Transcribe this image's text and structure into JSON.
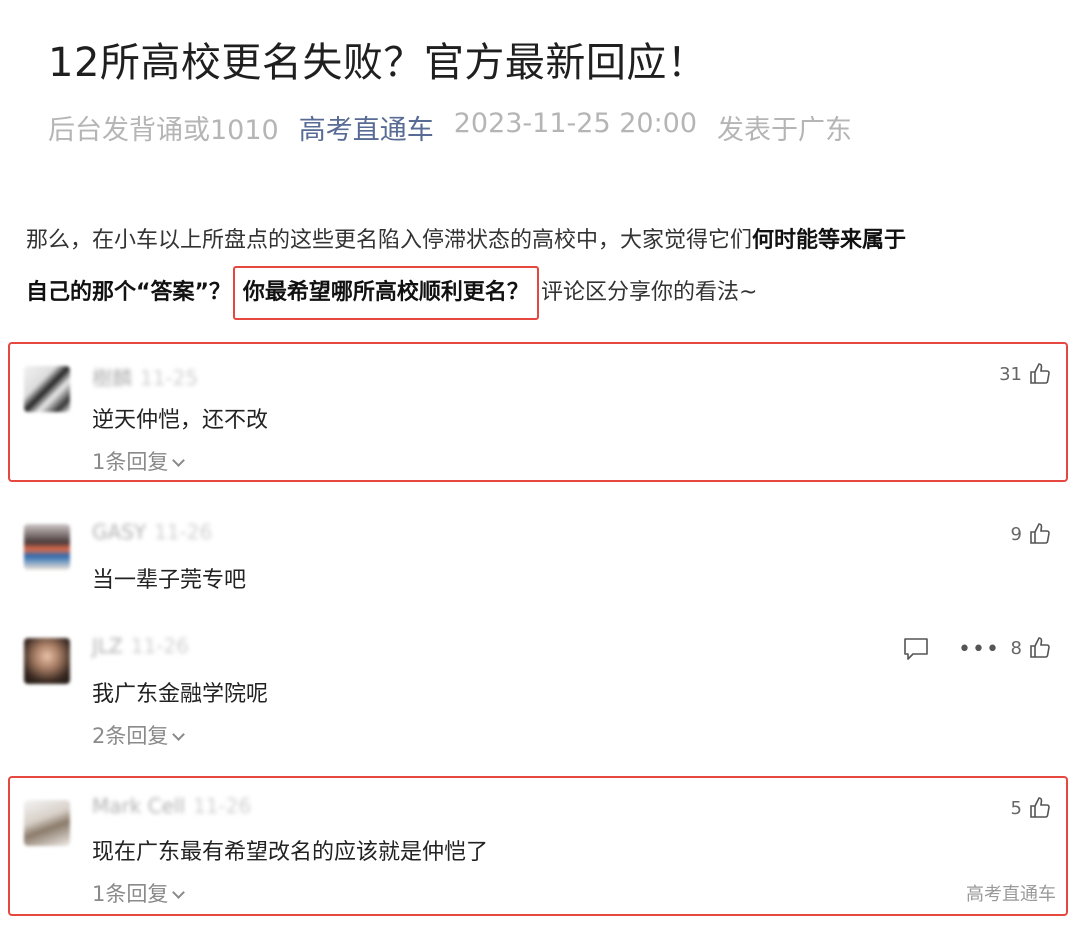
{
  "article": {
    "title": "12所高校更名失败？官方最新回应！",
    "meta_hint": "后台发背诵或1010",
    "account": "高考直通车",
    "datetime": "2023-11-25 20:00",
    "location": "发表于广东"
  },
  "intro": {
    "line1_plain": "那么，在小车以上所盘点的这些更名陷入停滞状态的高校中，大家觉得它们",
    "line1_bold": "何时能等来属于",
    "line2_bold_a": "自己的那个“答案”？",
    "line2_boxed_bold": "你最希望哪所高校顺利更名？",
    "line2_plain": "评论区分享你的看法~"
  },
  "comments": [
    {
      "nickname": "樹麟",
      "date": "11-25",
      "text": "逆天仲恺，还不改",
      "likes": "31",
      "replies": "1条回复"
    },
    {
      "nickname": "GASY",
      "date": "11-26",
      "text": "当一辈子莞专吧",
      "likes": "9",
      "replies": ""
    },
    {
      "nickname": "JLZ",
      "date": "11-26",
      "text": "我广东金融学院呢",
      "likes": "8",
      "replies": "2条回复"
    },
    {
      "nickname": "Mark Cell",
      "date": "11-26",
      "text": "现在广东最有希望改名的应该就是仲恺了",
      "likes": "5",
      "replies": "1条回复"
    }
  ],
  "watermark": "高考直通车",
  "colors": {
    "highlight_frame": "#e5483f",
    "account_link": "#576b95",
    "meta_gray": "#b5b5b5"
  },
  "icons": [
    "thumbs-up-icon",
    "comment-icon",
    "more-icon",
    "chevron-down-icon"
  ]
}
